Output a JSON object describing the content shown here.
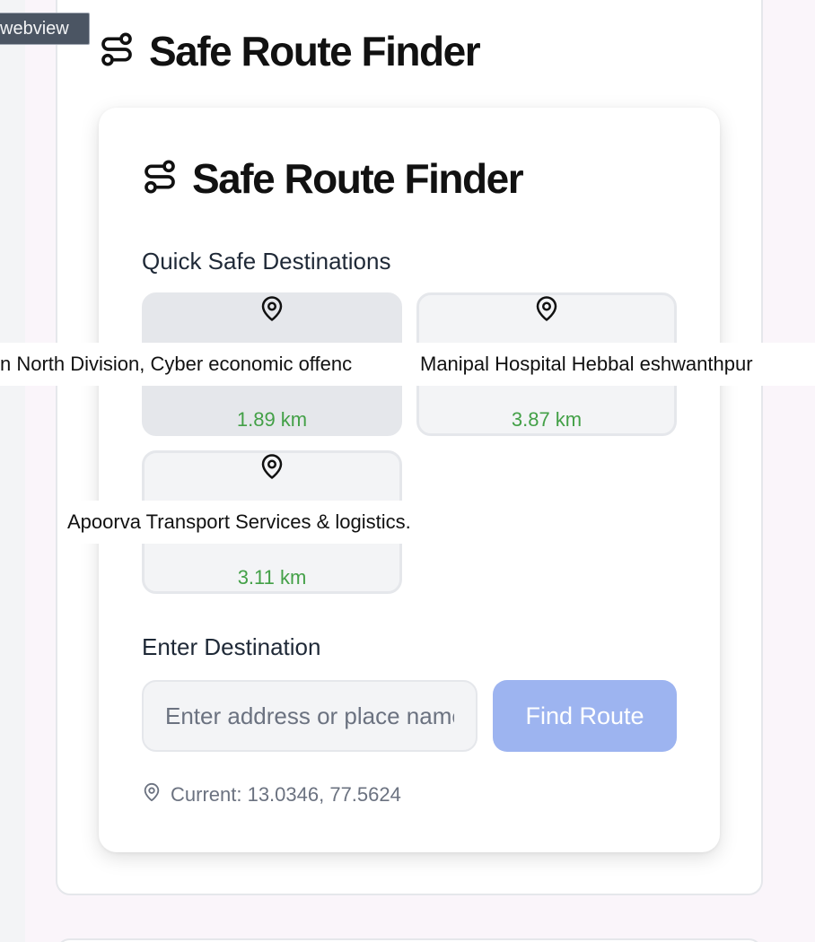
{
  "debug_tag": "webview",
  "app": {
    "title": "Safe Route Finder"
  },
  "card": {
    "title": "Safe Route Finder",
    "quick_label": "Quick Safe Destinations",
    "destinations": [
      {
        "name": "n North Division, Cyber economic offenc",
        "distance": "1.89 km",
        "icon": "map-pin-icon"
      },
      {
        "name": "Manipal Hospital Hebbal eshwanthpur",
        "distance": "3.87 km",
        "icon": "map-pin-icon"
      },
      {
        "name": "Apoorva Transport Services & logistics.",
        "distance": "3.11 km",
        "icon": "map-pin-icon"
      }
    ],
    "enter_label": "Enter Destination",
    "input": {
      "placeholder": "Enter address or place name",
      "value": ""
    },
    "find_button": "Find Route",
    "current": "Current: 13.0346, 77.5624"
  },
  "colors": {
    "distance": "#43a047",
    "button": "#9db4f0",
    "muted": "#6b7280"
  }
}
